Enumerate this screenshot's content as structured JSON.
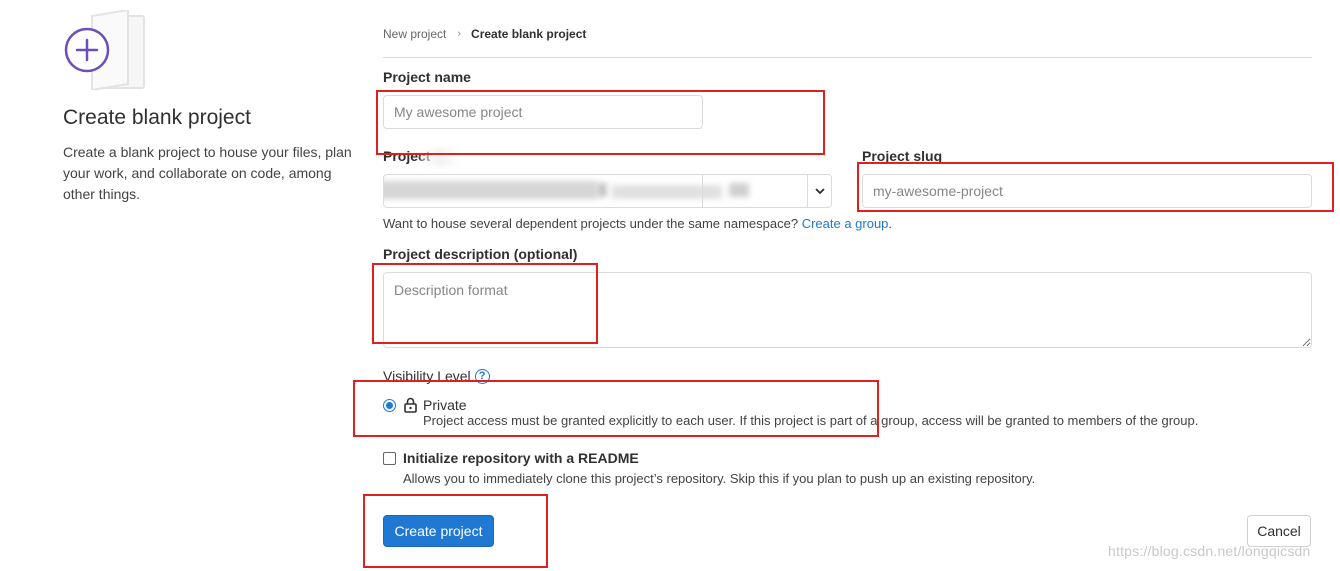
{
  "sidebar": {
    "title": "Create blank project",
    "description": "Create a blank project to house your files, plan your work, and collaborate on code, among other things."
  },
  "breadcrumb": {
    "parent": "New project",
    "separator": "›",
    "current": "Create blank project"
  },
  "form": {
    "project_name_label": "Project name",
    "project_name_placeholder": "My awesome project",
    "project_url_label": "Project",
    "project_slug_label": "Project slug",
    "project_slug_placeholder": "my-awesome-project",
    "namespace_help": "Want to house several dependent projects under the same namespace?",
    "namespace_link": "Create a group",
    "namespace_help_end": ".",
    "description_label": "Project description (optional)",
    "description_placeholder": "Description format",
    "visibility_label": "Visibility Level",
    "visibility_help_icon": "question-circle-icon",
    "visibility_option": "Private",
    "visibility_option_icon": "lock-icon",
    "visibility_option_desc": "Project access must be granted explicitly to each user. If this project is part of a group, access will be granted to members of the group.",
    "readme_label": "Initialize repository with a README",
    "readme_desc": "Allows you to immediately clone this project’s repository. Skip this if you plan to push up an existing repository.",
    "readme_checked": false,
    "visibility_selected": true
  },
  "actions": {
    "create_label": "Create project",
    "cancel_label": "Cancel"
  },
  "watermark": "https://blog.csdn.net/longqicsdn",
  "colors": {
    "primary": "#1f78d1",
    "annotation": "#e02020",
    "illustration_accent": "#6b4fbb"
  }
}
